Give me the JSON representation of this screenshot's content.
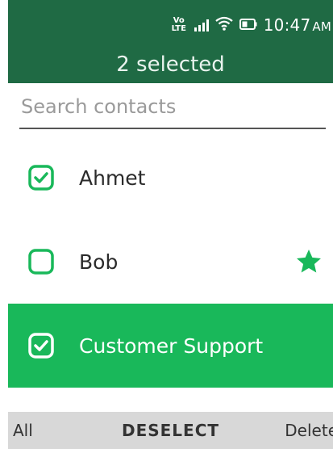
{
  "status_bar": {
    "volte_label": "Vo LTE",
    "time": "10:47",
    "ampm": "AM",
    "icons": [
      "volte-icon",
      "signal-icon",
      "wifi-icon",
      "battery-icon"
    ]
  },
  "header": {
    "title": "2 selected"
  },
  "search": {
    "placeholder": "Search contacts",
    "value": ""
  },
  "contacts": [
    {
      "name": "Ahmet",
      "checked": true,
      "starred": false,
      "focused": false
    },
    {
      "name": "Bob",
      "checked": false,
      "starred": true,
      "focused": false
    },
    {
      "name": "Customer Support",
      "checked": true,
      "starred": false,
      "focused": true
    }
  ],
  "softkeys": {
    "left": "All",
    "center": "DESELECT",
    "right": "Delete"
  },
  "colors": {
    "header_bg": "#1f6a44",
    "accent_green": "#19b85a",
    "softkey_bg": "#d8d8d8"
  }
}
